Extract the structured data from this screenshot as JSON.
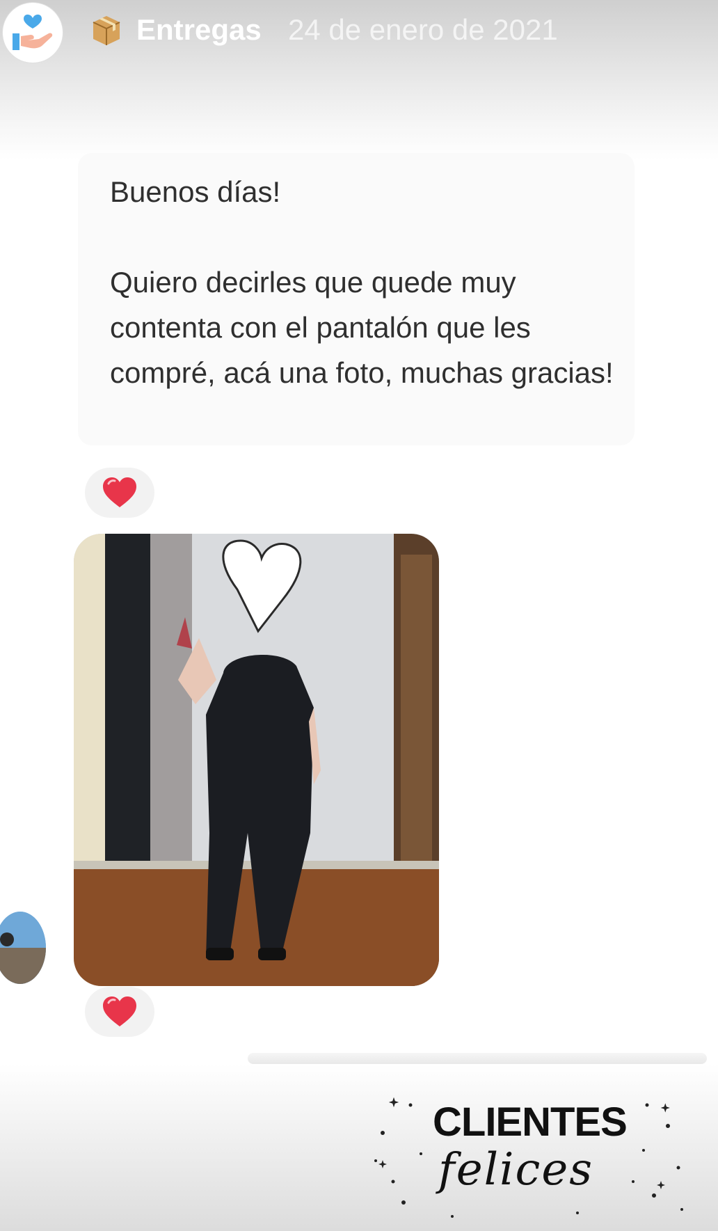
{
  "story": {
    "channel_icon": "package-icon",
    "channel_name": "Entregas",
    "date": "24 de enero de 2021"
  },
  "message": {
    "greeting": "Buenos días!",
    "body": "Quiero decirles que quede muy contenta con el pantalón que les compré, acá una foto, muchas gracias!",
    "reaction_icon": "heart-icon"
  },
  "photo": {
    "overlay_icon": "heart-outline-icon"
  },
  "brand": {
    "title": "CLIENTES",
    "script": "felices"
  },
  "colors": {
    "reaction_heart": "#e8354a",
    "avatar_heart": "#4aa9e9",
    "brand_text": "#111111"
  }
}
